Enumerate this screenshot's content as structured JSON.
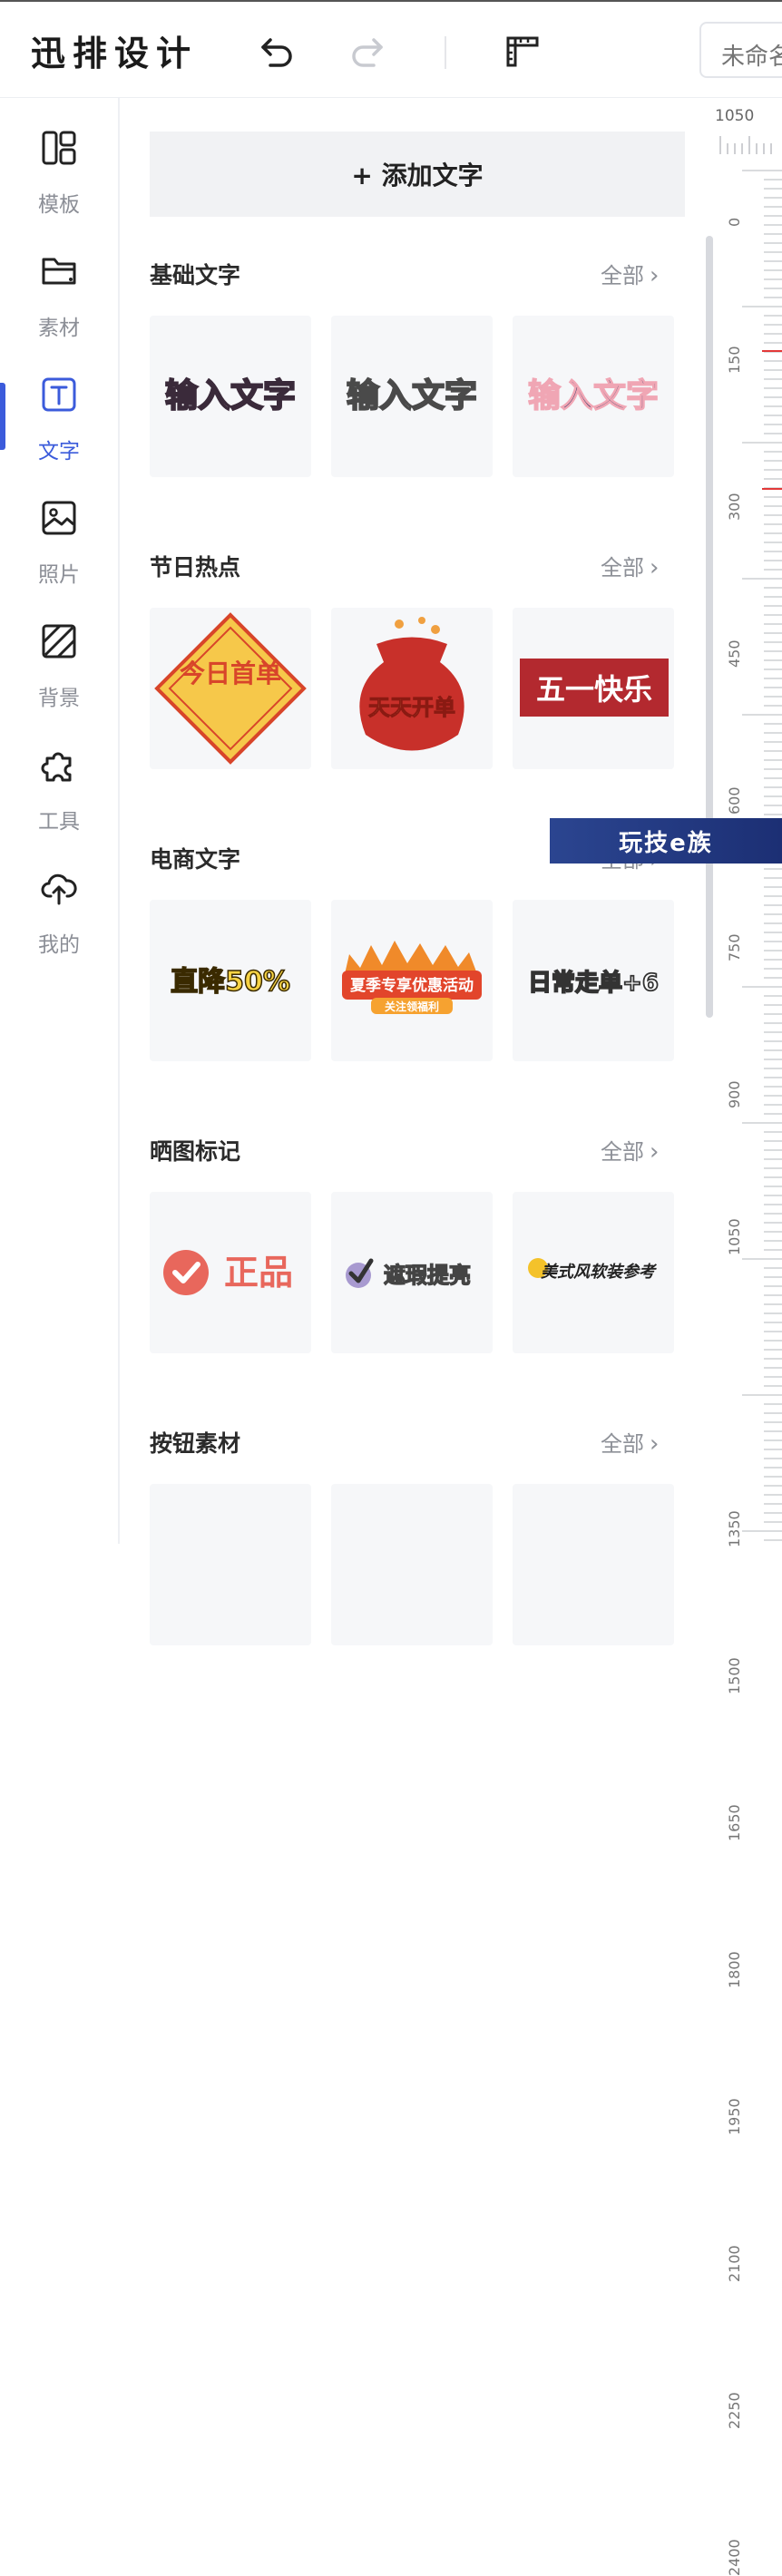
{
  "app": {
    "logo": "迅排设计"
  },
  "toolbar": {
    "filename_placeholder": "未命名"
  },
  "sidebar": {
    "items": [
      {
        "label": "模板",
        "icon": "template-icon"
      },
      {
        "label": "素材",
        "icon": "folder-icon"
      },
      {
        "label": "文字",
        "icon": "text-icon"
      },
      {
        "label": "照片",
        "icon": "image-icon"
      },
      {
        "label": "背景",
        "icon": "background-icon"
      },
      {
        "label": "工具",
        "icon": "puzzle-icon"
      },
      {
        "label": "我的",
        "icon": "cloud-upload-icon"
      }
    ],
    "active": "文字"
  },
  "panel": {
    "add_text_label": "+ 添加文字",
    "sections": [
      {
        "title": "基础文字",
        "all": "全部",
        "cards": [
          "输入文字",
          "输入文字",
          "输入文字"
        ]
      },
      {
        "title": "节日热点",
        "all": "全部",
        "cards": [
          "今日首单",
          "天天开单",
          "五一快乐"
        ]
      },
      {
        "title": "电商文字",
        "all": "全部",
        "cards": [
          "直降50%",
          "夏季专享优惠活动",
          "日常走单+6"
        ],
        "card_extra": {
          "1": "关注领福利"
        }
      },
      {
        "title": "晒图标记",
        "all": "全部",
        "cards": [
          "正品",
          "遮瑕提亮",
          "美式风软装参考"
        ]
      },
      {
        "title": "按钮素材",
        "all": "全部",
        "cards": []
      }
    ]
  },
  "ruler": {
    "top_value": "1050",
    "labels": [
      "0",
      "150",
      "300",
      "450",
      "600",
      "750",
      "900",
      "1050",
      "1350",
      "1500",
      "1650",
      "1800",
      "1950",
      "2100",
      "2250",
      "2400"
    ]
  },
  "watermark": {
    "text": "玩技e族"
  },
  "colors": {
    "accent": "#3b5bdb",
    "red": "#e23838",
    "card_bg": "#f6f7f9"
  }
}
